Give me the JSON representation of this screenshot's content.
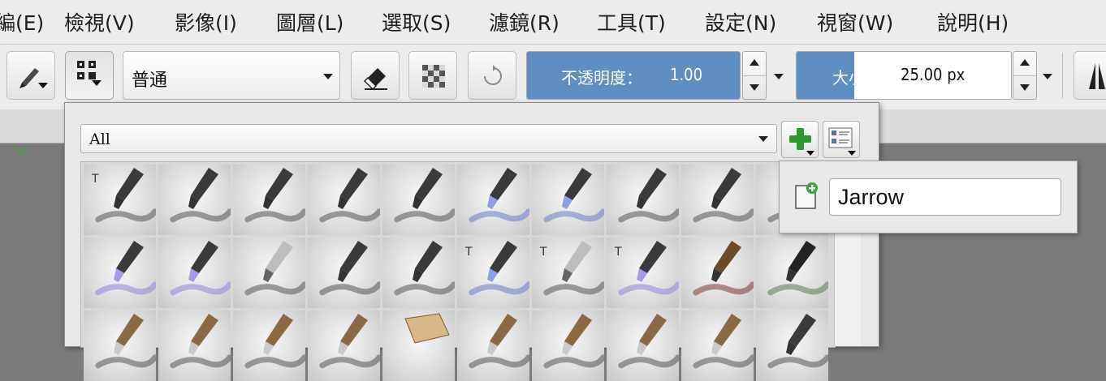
{
  "menu": {
    "items": [
      "編(E)",
      "檢視(V)",
      "影像(I)",
      "圖層(L)",
      "選取(S)",
      "濾鏡(R)",
      "工具(T)",
      "設定(N)",
      "視窗(W)",
      "說明(H)"
    ]
  },
  "toolbar": {
    "blend_mode": "普通",
    "opacity": {
      "label": "不透明度：",
      "value": "1.00",
      "fraction": 1.0
    },
    "size": {
      "label": "大小：",
      "value": "25.00 px",
      "fraction": 0.27
    }
  },
  "preset_popup": {
    "tag_value": "All",
    "brush_tiles": [
      "pen-texture",
      "pen-soft",
      "pen-scribble",
      "pen-dark",
      "marker-wet",
      "pencil-blue",
      "pencil-blue-light",
      "pen-ink",
      "pen-ink-soft",
      "pen-grey",
      "pencil-lavender",
      "pencil-violet",
      "marker-wide",
      "marker-dark",
      "marker-smudge",
      "pencil-text-blue",
      "marker-text-grey",
      "pencil-text-violet",
      "brush-thin-red",
      "brush-thin-green",
      "brush-flat",
      "brush-flat",
      "brush-small",
      "brush-small",
      "sponge",
      "pencil",
      "pencil",
      "pencil",
      "pencil",
      "marker-black"
    ]
  },
  "tag_popup": {
    "input_value": "Jarrow"
  },
  "colors": {
    "accent": "#5f8fc0",
    "add_green": "#2e9a2e"
  }
}
